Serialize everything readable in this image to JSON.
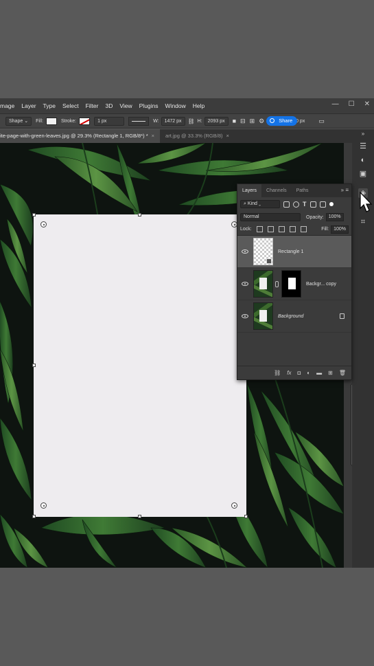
{
  "menubar": {
    "items": [
      "mage",
      "Layer",
      "Type",
      "Select",
      "Filter",
      "3D",
      "View",
      "Plugins",
      "Window",
      "Help"
    ],
    "minimize": "—",
    "maximize": "☐",
    "close": "✕"
  },
  "options": {
    "tool_mode": "Shape",
    "fill_label": "Fill:",
    "stroke_label": "Stroke:",
    "stroke_width": "1 px",
    "w_label": "W:",
    "w_value": "1472 px",
    "h_label": "H:",
    "h_value": "2093 px",
    "share_label": "Share",
    "radius_value": "10 px"
  },
  "tabs": [
    {
      "label": "ite-page-with-green-leaves.jpg @ 29.3% (Rectangle 1, RGB/8*) *",
      "close": "×"
    },
    {
      "label": "art.jpg @ 33.3% (RGB/8)",
      "close": "×"
    }
  ],
  "layers_panel": {
    "tabs": [
      "Layers",
      "Channels",
      "Paths"
    ],
    "filter_kind": "Kind",
    "blend_mode": "Normal",
    "opacity_label": "Opacity:",
    "opacity_value": "100%",
    "lock_label": "Lock:",
    "fill_label": "Fill:",
    "fill_value": "100%",
    "layers": [
      {
        "name": "Rectangle 1"
      },
      {
        "name": "Backgr... copy"
      },
      {
        "name": "Background"
      }
    ],
    "footer_icons": [
      "link-icon",
      "fx-icon",
      "mask-icon",
      "adjustment-icon",
      "folder-icon",
      "new-layer-icon",
      "trash-icon"
    ]
  },
  "colors": {
    "accent": "#1473e6",
    "panel_bg": "#3b3b3b",
    "canvas_bg": "#0e1410",
    "paper": "#eeecef"
  }
}
